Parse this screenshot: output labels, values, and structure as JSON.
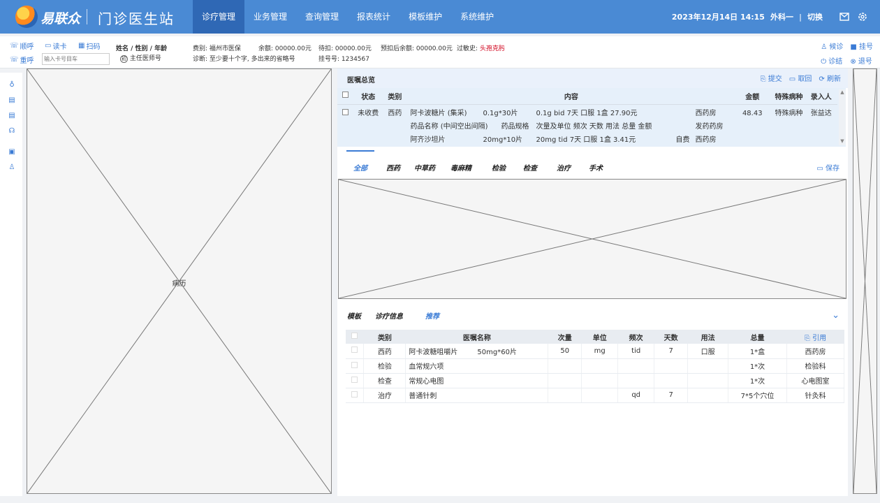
{
  "header": {
    "brand": "易联众",
    "site_title": "门诊医生站",
    "nav": [
      "诊疗管理",
      "业务管理",
      "查询管理",
      "报表统计",
      "模板维护",
      "系统维护"
    ],
    "datetime": "2023年12月14日 14:15",
    "department": "外科一",
    "switch_label": "切换",
    "icons": [
      "mail-icon",
      "settings-icon"
    ]
  },
  "infobar": {
    "tools": {
      "call_next": "顺呼",
      "read_card": "读卡",
      "scan": "扫码",
      "recall": "重呼"
    },
    "card_placeholder": "输入卡号目车",
    "patient_label": "姓名 / 性别 / 年龄",
    "doctor_tag": "初",
    "doctor_label": "主任医师号",
    "fee_type": "费别: 福州市医保",
    "balance": "余额: 00000.00元",
    "pending": "待扣: 00000.00元",
    "after_balance": "预扣后余额: 00000.00元",
    "allergy_label": "过敏史:",
    "allergy_value": "头孢克肟",
    "diagnosis": "诊断: 至少要十个字, 多出来的省略号",
    "reg_no": "挂号号: 1234567",
    "right_tools": [
      "候诊",
      "挂号",
      "诊结",
      "退号"
    ]
  },
  "left_panel": {
    "label": "病历"
  },
  "prescription": {
    "title": "医嘱总览",
    "actions": [
      "提交",
      "取回",
      "刷新"
    ],
    "columns": [
      "状态",
      "类别",
      "内容",
      "金额",
      "特殊病种",
      "录入人"
    ],
    "row": {
      "status": "未收费",
      "category": "西药",
      "lines": [
        {
          "name": "阿卡波糖片 (集采)",
          "spec": "0.1g*30片",
          "usage": "0.1g bid 7天 口服 1盒 27.90元",
          "self": "",
          "pharmacy": "西药房"
        },
        {
          "name": "药品名称 (中间空出间隔)",
          "spec": "药品规格",
          "usage": "次量及单位 频次 天数 用法 总量 金额",
          "self": "",
          "pharmacy": "发药药房"
        },
        {
          "name": "阿齐沙坦片",
          "spec": "20mg*10片",
          "usage": "20mg tid 7天 口服 1盒 3.41元",
          "self": "自费",
          "pharmacy": "西药房"
        }
      ],
      "amount": "48.43",
      "special": "特殊病种",
      "entered_by": "张益达"
    }
  },
  "tabs": {
    "items": [
      "全部",
      "西药",
      "中草药",
      "毒麻精",
      "检验",
      "检查",
      "治疗",
      "手术"
    ],
    "save": "保存"
  },
  "advice": {
    "tabs": [
      "模板",
      "诊疗信息",
      "推荐"
    ],
    "cite": "引用",
    "columns": [
      "类别",
      "医嘱名称",
      "次量",
      "单位",
      "频次",
      "天数",
      "用法",
      "总量"
    ],
    "rows": [
      {
        "cat": "西药",
        "name": "阿卡波糖咀嚼片",
        "spec": "50mg*60片",
        "dose": "50",
        "unit": "mg",
        "freq": "tid",
        "days": "7",
        "route": "口服",
        "total": "1*盒",
        "dept": "西药房"
      },
      {
        "cat": "检验",
        "name": "血常规六项",
        "spec": "",
        "dose": "",
        "unit": "",
        "freq": "",
        "days": "",
        "route": "",
        "total": "1*次",
        "dept": "检验科"
      },
      {
        "cat": "检查",
        "name": "常规心电图",
        "spec": "",
        "dose": "",
        "unit": "",
        "freq": "",
        "days": "",
        "route": "",
        "total": "1*次",
        "dept": "心电图室"
      },
      {
        "cat": "治疗",
        "name": "普通针刺",
        "spec": "",
        "dose": "",
        "unit": "",
        "freq": "qd",
        "days": "7",
        "route": "",
        "total": "7*5个穴位",
        "dept": "针灸科"
      }
    ]
  }
}
